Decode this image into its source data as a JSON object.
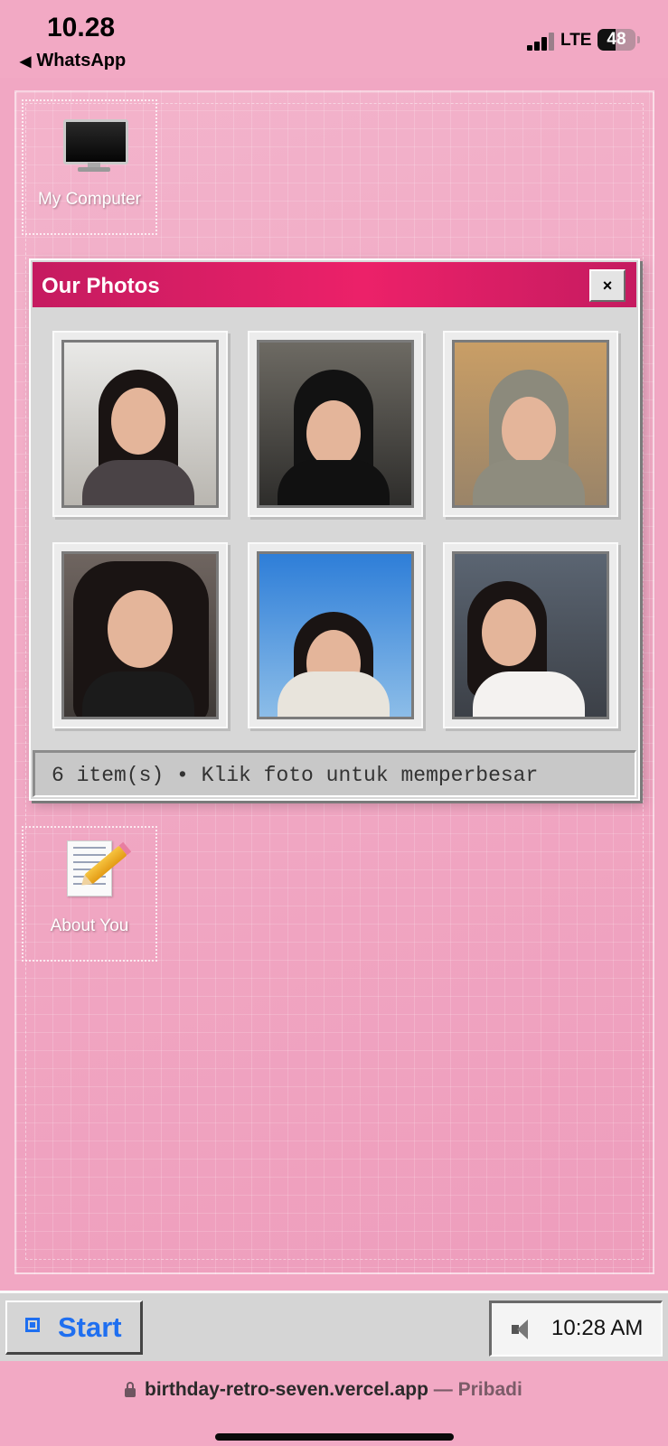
{
  "status_bar": {
    "time": "10.28",
    "back_app": "WhatsApp",
    "network": "LTE",
    "battery": "48"
  },
  "desktop": {
    "icons": [
      {
        "label": "My Computer",
        "icon": "monitor-icon"
      },
      {
        "label": "About You",
        "icon": "notepad-icon"
      }
    ]
  },
  "window": {
    "title": "Our Photos",
    "close_label": "×",
    "photos": [
      {
        "icon": "photo-1"
      },
      {
        "icon": "photo-2"
      },
      {
        "icon": "photo-3"
      },
      {
        "icon": "photo-4"
      },
      {
        "icon": "photo-5"
      },
      {
        "icon": "photo-6"
      }
    ],
    "status_text": "6 item(s) • Klik foto untuk memperbesar"
  },
  "taskbar": {
    "start_label": "Start",
    "clock": "10:28 AM",
    "tray_icon": "speaker-icon"
  },
  "browser": {
    "url": "birthday-retro-seven.vercel.app",
    "separator": " — ",
    "privacy": "Pribadi"
  },
  "colors": {
    "titlebar_accent": "#ec2169",
    "start_blue": "#1f6ff0",
    "desktop_pink": "#f1a5c1"
  }
}
